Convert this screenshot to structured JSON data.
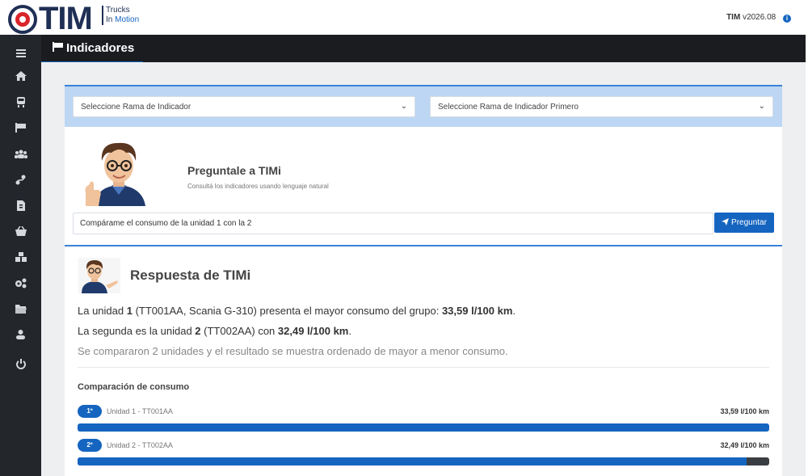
{
  "header": {
    "logo_text": "TIM",
    "logo_tag_1": "Trucks",
    "logo_tag_2": "In",
    "logo_tag_3": "Motion",
    "version_app": "TIM",
    "version_number": "v2026.08"
  },
  "sidebar": {
    "items": [
      "menu-icon",
      "home-icon",
      "truck-icon",
      "flag-icon",
      "users-icon",
      "route-icon",
      "document-icon",
      "basket-icon",
      "boxes-icon",
      "cogs-icon",
      "folder-icon",
      "user-icon",
      "power-icon"
    ]
  },
  "page": {
    "title": "Indicadores"
  },
  "filters": {
    "branch_placeholder": "Seleccione Rama de Indicador",
    "indicator_placeholder": "Seleccione Rama de Indicador Primero"
  },
  "ask": {
    "title": "Preguntale a TIMi",
    "subtitle": "Consultá los indicadores usando lenguaje natural",
    "query": "Compárame el consumo de la unidad 1 con la 2",
    "button_label": "Preguntar"
  },
  "response": {
    "title": "Respuesta de TIMi",
    "line1_a": "La unidad ",
    "line1_b": "1",
    "line1_c": " (TT001AA, Scania G-310) presenta el mayor consumo del grupo: ",
    "line1_d": "33,59 l/100 km",
    "line1_e": ".",
    "line2_a": "La segunda es la unidad ",
    "line2_b": "2",
    "line2_c": " (TT002AA) con ",
    "line2_d": "32,49 l/100 km",
    "line2_e": ".",
    "line3": "Se compararon 2 unidades y el resultado se muestra ordenado de mayor a menor consumo."
  },
  "comparison": {
    "title": "Comparación de consumo",
    "rows": [
      {
        "rank": "1º",
        "label": "Unidad 1 - TT001AA",
        "value": "33,59 l/100 km",
        "fraction": 1.0
      },
      {
        "rank": "2º",
        "label": "Unidad 2 - TT002AA",
        "value": "32,49 l/100 km",
        "fraction": 0.967
      }
    ]
  },
  "colors": {
    "accent": "#1565c0",
    "sidebar": "#23262b",
    "titlebar": "#1a1c1f",
    "filter_strip": "#bcd6f3"
  }
}
